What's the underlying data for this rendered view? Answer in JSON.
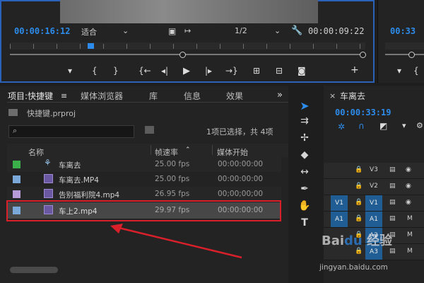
{
  "monitor": {
    "current_time": "00:00:16:12",
    "fit_option": "适合",
    "resolution": "1/2",
    "duration": "00:00:09:22",
    "secondary_time": "00:33"
  },
  "transport": {
    "buttons": [
      "marker-icon",
      "mark-in-icon",
      "mark-out-icon",
      "go-to-in-icon",
      "step-back-icon",
      "play-icon",
      "step-forward-icon",
      "go-to-out-icon",
      "lift-icon",
      "extract-icon",
      "export-frame-icon",
      "add-button-icon"
    ]
  },
  "project_panel": {
    "tabs": [
      "项目:快捷键",
      "媒体浏览器",
      "库",
      "信息",
      "效果"
    ],
    "active_tab": "项目:快捷键",
    "more_icon": "»",
    "project_file": "快捷键.prproj",
    "selection_status": "1项已选择，共 4项",
    "columns": {
      "name": "名称",
      "frame_rate": "帧速率",
      "media_start": "媒体开始"
    },
    "items": [
      {
        "name": "车离去",
        "fps": "25.00 fps",
        "start": "00:00:00:00",
        "color": "#3bb04a",
        "kind": "sequence"
      },
      {
        "name": "车离去.MP4",
        "fps": "25.00 fps",
        "start": "00:00:00:00",
        "color": "#7aa8d8",
        "kind": "video"
      },
      {
        "name": "告别福利院4.mp4",
        "fps": "26.95 fps",
        "start": "00;00;00;00",
        "color": "#b79ad8",
        "kind": "video"
      },
      {
        "name": "车上2.mp4",
        "fps": "29.97 fps",
        "start": "00:00:00:00",
        "color": "#7aa8d8",
        "kind": "video",
        "selected": true
      }
    ]
  },
  "timeline": {
    "sequence_name": "车离去",
    "timecode": "00:00:33:19",
    "tracks": [
      {
        "label": "V3",
        "src": ""
      },
      {
        "label": "V2",
        "src": ""
      },
      {
        "label": "V1",
        "src": "V1"
      },
      {
        "label": "A1",
        "src": "A1"
      },
      {
        "label": "A2",
        "src": ""
      },
      {
        "label": "A3",
        "src": ""
      }
    ]
  },
  "tools": [
    "selection-tool-icon",
    "track-select-icon",
    "ripple-edit-icon",
    "razor-icon",
    "slip-icon",
    "pen-icon",
    "hand-icon",
    "type-icon"
  ],
  "colors": {
    "accent": "#2d8ceb",
    "highlight": "#d9202a",
    "panel": "#232323"
  },
  "watermark": "Baidu 经验 jingyan.baidu.com"
}
